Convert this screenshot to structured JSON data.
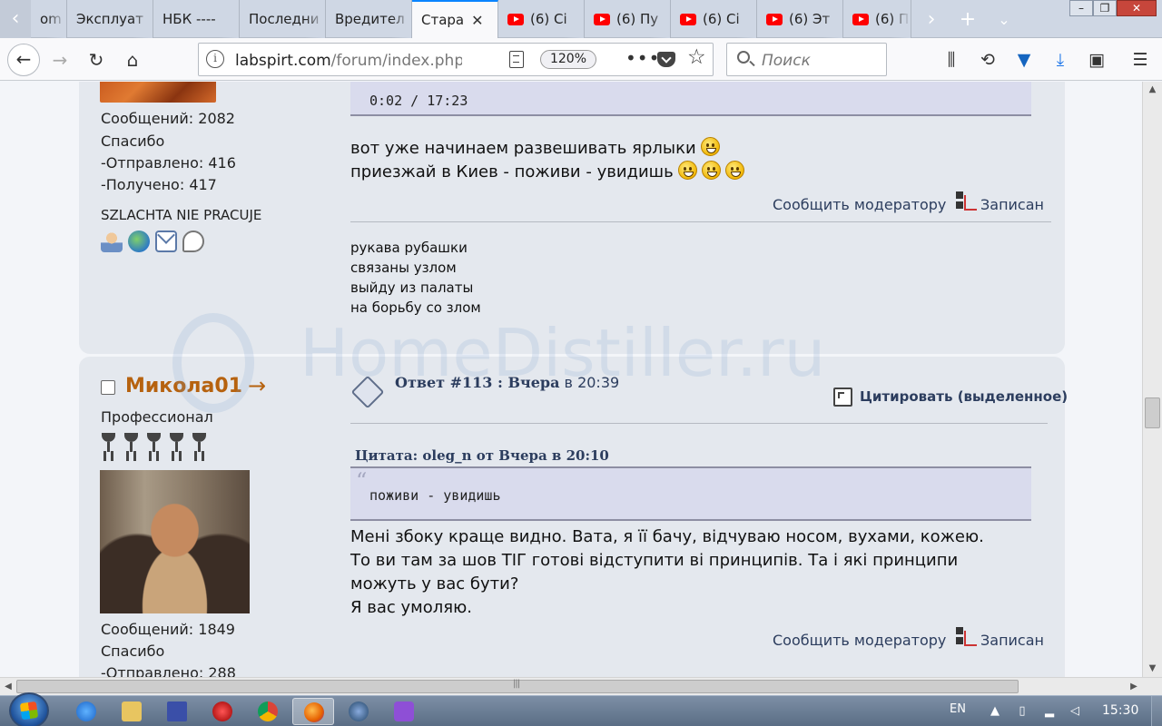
{
  "browser": {
    "tabs": [
      {
        "label": "om",
        "type": "text",
        "width": 40
      },
      {
        "label": "Эксплуат",
        "type": "text",
        "width": 95
      },
      {
        "label": "НБК ---- ",
        "type": "text",
        "width": 95
      },
      {
        "label": "Последни",
        "type": "text",
        "width": 95
      },
      {
        "label": "Вредител",
        "type": "text",
        "width": 95
      },
      {
        "label": "Стара",
        "type": "active",
        "width": 95
      },
      {
        "label": "(6) Сі",
        "type": "yt",
        "width": 95
      },
      {
        "label": "(6) Пу",
        "type": "yt",
        "width": 95
      },
      {
        "label": "(6) Сі",
        "type": "yt",
        "width": 95
      },
      {
        "label": "(6) Эт",
        "type": "yt",
        "width": 95
      },
      {
        "label": "(6) П",
        "type": "yt",
        "width": 75
      }
    ],
    "url": {
      "domain": "labspirt.com",
      "path": "/forum/index.php"
    },
    "zoom": "120%",
    "search_placeholder": "Поиск",
    "close_tab_glyph": "✕"
  },
  "post1": {
    "video_time": "0:02 / 17:23",
    "stats": {
      "messages": "Сообщений: 2082",
      "thanks": "Спасибо",
      "sent": "-Отправлено: 416",
      "received": "-Получено: 417"
    },
    "signature_author": "SZLACHTA NIE PRACUJE",
    "body_lines": [
      "вот  уже  начинаем  развешивать ярлыки",
      "приезжай  в  Киев - поживи -  увидишь"
    ],
    "report": "Сообщить модератору",
    "logged": "Записан",
    "signature_lines": [
      "рукава рубашки",
      "связаны узлом",
      "выйду из палаты",
      "на борьбу со злом"
    ]
  },
  "watermark": "HomeDistiller.ru",
  "post2": {
    "author": "Микола01",
    "arrow": "→",
    "rank": "Профессионал",
    "reply_number": "Ответ #113 : Вчера",
    "reply_time": "в 20:39",
    "quote_button": "Цитировать (выделенное)",
    "quote_header": "Цитата: oleg_n от Вчера в 20:10",
    "quote_text": "поживи -  увидишь",
    "body_lines": [
      "Мені збоку краще видно. Вата, я її бачу, відчуваю носом, вухами, кожею.",
      "То ви там за шов ТІГ готові відступити ві принципів. Та і які принципи",
      "можуть у вас бути?",
      "Я вас умоляю."
    ],
    "report": "Сообщить модератору",
    "logged": "Записан",
    "stats": {
      "messages": "Сообщений: 1849",
      "thanks": "Спасибо",
      "sent": "-Отправлено: 288"
    }
  },
  "taskbar": {
    "language": "EN",
    "clock": "15:30"
  }
}
